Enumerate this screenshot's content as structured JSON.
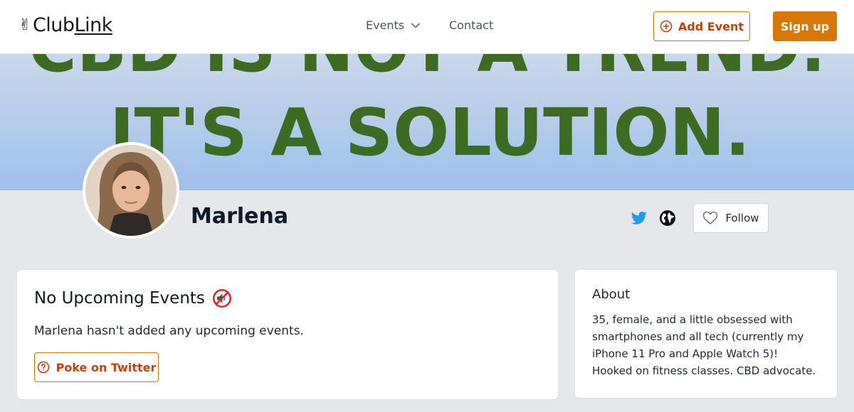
{
  "header": {
    "logo_emoji": "✌",
    "logo_text_a": "Club",
    "logo_text_b": "Link",
    "nav": {
      "events_label": "Events",
      "contact_label": "Contact"
    },
    "add_event_label": "Add Event",
    "signup_label": "Sign up"
  },
  "banner": {
    "line1": "CBD IS NOT A TREND.",
    "line2": "IT'S A SOLUTION."
  },
  "profile": {
    "name": "Marlena",
    "follow_label": "Follow"
  },
  "events_card": {
    "title": "No Upcoming Events",
    "message": "Marlena hasn't added any upcoming events.",
    "poke_label": "Poke on Twitter"
  },
  "about_card": {
    "title": "About",
    "text": "35, female, and a little obsessed with smartphones and all tech (currently my iPhone 11 Pro and Apple Watch 5)! Hooked on fitness classes. CBD advocate."
  },
  "icons": {
    "logo": "victory-hand-icon",
    "dropdown": "chevron-down-icon",
    "add": "plus-circle-icon",
    "twitter": "twitter-icon",
    "website": "globe-icon",
    "follow": "heart-icon",
    "muted": "muted-speaker-icon",
    "poke": "question-circle-icon"
  },
  "colors": {
    "accent": "#d97706",
    "accent_text": "#c2410c",
    "twitter": "#1d9bf0",
    "banner_text": "#3d6b22",
    "background": "#e5e7eb"
  }
}
